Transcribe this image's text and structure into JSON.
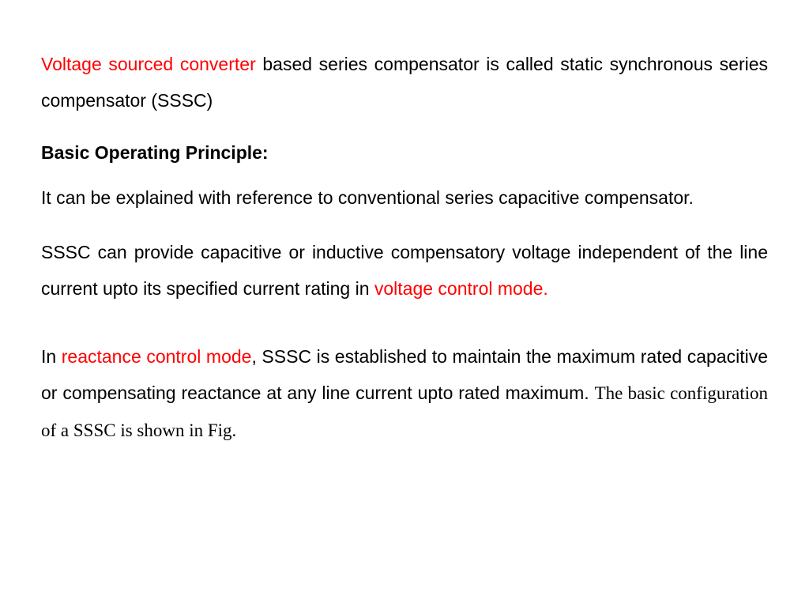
{
  "p1": {
    "red": "Voltage sourced converter",
    "rest": " based series compensator is called static synchronous series compensator (SSSC)"
  },
  "h1": "Basic Operating Principle:",
  "p2": "It can be explained with reference to conventional series capacitive compensator.",
  "p3": {
    "a": "SSSC can provide capacitive or inductive compensatory voltage independent of the line current upto its specified current rating in ",
    "red": "voltage control mode."
  },
  "p4": {
    "a": "In ",
    "red": "reactance control mode",
    "b": ", SSSC is established to maintain the maximum rated capacitive or compensating reactance at any line current upto rated maximum. ",
    "serif": "The basic configuration of a SSSC is shown in Fig."
  }
}
